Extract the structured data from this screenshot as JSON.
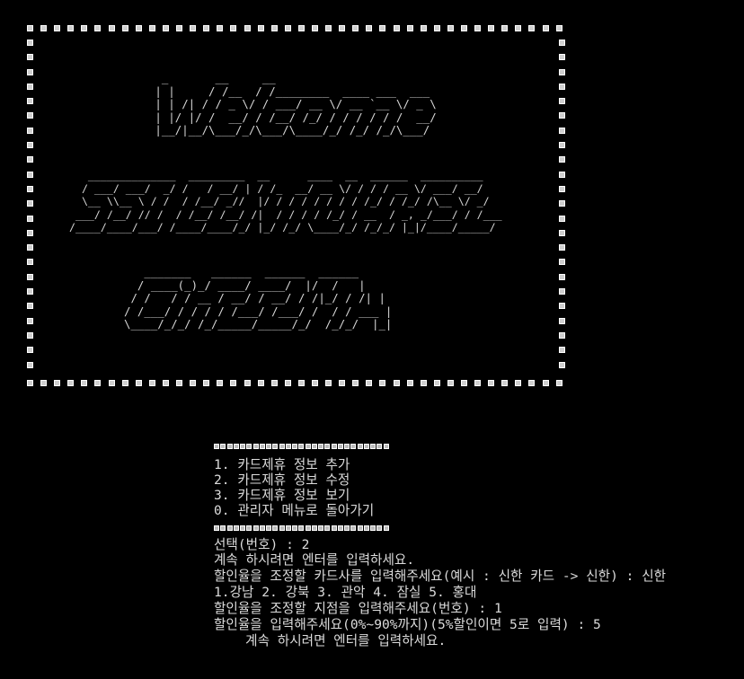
{
  "banner": {
    "art_welcome": "    _       __     __\n   | |     / /__  / /________  ____ ___  ___\n   | | /| / / _ \\/ / ___/ __ \\/ __ `__ \\/ _ \\\n   | |/ |/ /  __/ / /__/ /_/ / / / / / /  __/\n   |__/|__/\\___/_/\\___/\\____/_/ /_/ /_/\\___/",
    "art_ssi": "    ______________  _________  __      ____  __  ______  __________\n   / ___/ ___/  _/ /   / __/ | / /_  __/ __ \\/ / / / __ \\/ ___/ __/\n   \\__ \\\\__ \\ / /  / /__/ _//  |/ / / / / / / / /_/ / /_/ /\\__ \\/ _/\n  ___/ /__/ // /  / /__/ /__/ /|  / / / / /_/ / __  / _, _/___/ / /___\n /____/____/___/ /____/____/_/ |_/ /_/ \\____/_/ /_/_/ |_|/____/_____/",
    "art_cinema": "   _______   ______  ______  ______\n  / ____(_)_/ ____/ ____/  |/  /   |\n / /   / / __ / __/ / __/ / /|_/ / /| |\n/ /___/ / / / / /___/ /___/ /  / / ___ |\n\\____/_/_/ /_/_____/_____/_/  /_/_/  |_|"
  },
  "menu": {
    "items": [
      "1. 카드제휴 정보 추가",
      "2. 카드제휴 정보 수정",
      "3. 카드제휴 정보 보기",
      "0. 관리자 메뉴로 돌아가기"
    ]
  },
  "output": {
    "lines": [
      "선택(번호) : 2",
      "계속 하시려면 엔터를 입력하세요.",
      "할인율을 조정할 카드사를 입력해주세요(예시 : 신한 카드 -> 신한) : 신한",
      "1.강남 2. 강북 3. 관악 4. 잠실 5. 홍대",
      "할인율을 조정할 지점을 입력해주세요(번호) : 1",
      "할인율을 입력해주세요(0%~90%까지)(5%할인이면 5로 입력) : 5",
      "    계속 하시려면 엔터를 입력하세요."
    ]
  }
}
